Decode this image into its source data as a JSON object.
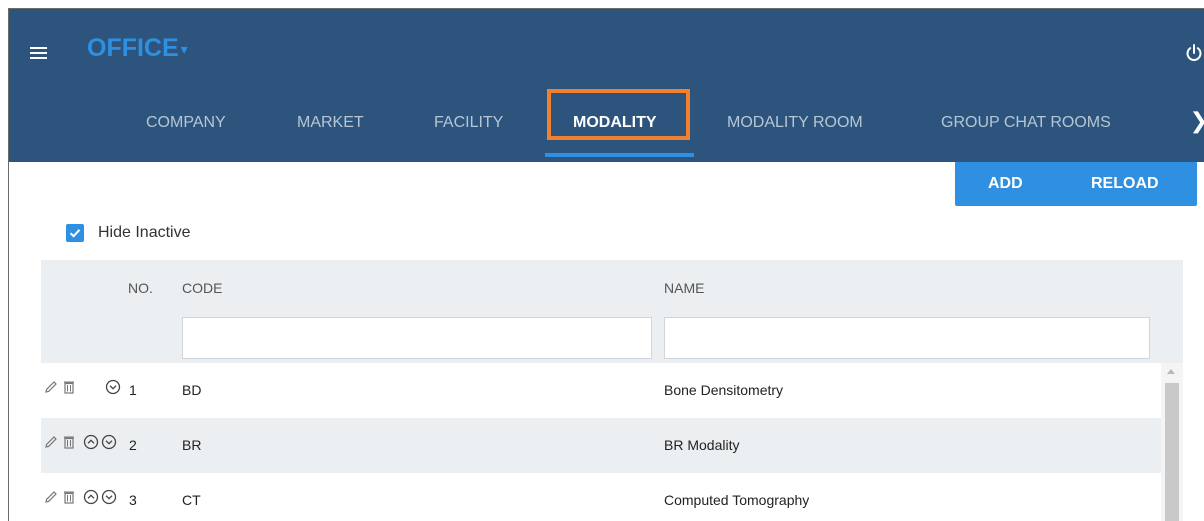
{
  "header": {
    "app_title": "OFFICE",
    "app_caret": "▾",
    "background": "#2c547c",
    "accent": "#2f8fe0"
  },
  "tabs": [
    {
      "label": "COMPANY",
      "active": false
    },
    {
      "label": "MARKET",
      "active": false
    },
    {
      "label": "FACILITY",
      "active": false
    },
    {
      "label": "MODALITY",
      "active": true
    },
    {
      "label": "MODALITY ROOM",
      "active": false
    },
    {
      "label": "GROUP CHAT ROOMS",
      "active": false
    }
  ],
  "tabs_next_glyph": "❯",
  "highlight_color": "#f2802e",
  "actions": {
    "add_label": "ADD",
    "reload_label": "RELOAD"
  },
  "filter": {
    "hide_inactive_label": "Hide Inactive",
    "hide_inactive_checked": true
  },
  "grid": {
    "columns": {
      "no": "NO.",
      "code": "CODE",
      "name": "NAME"
    },
    "rows": [
      {
        "no": "1",
        "code": "BD",
        "name": "Bone Densitometry",
        "can_move_up": false,
        "can_move_down": true
      },
      {
        "no": "2",
        "code": "BR",
        "name": "BR Modality",
        "can_move_up": true,
        "can_move_down": true
      },
      {
        "no": "3",
        "code": "CT",
        "name": "Computed Tomography",
        "can_move_up": true,
        "can_move_down": true
      }
    ]
  }
}
